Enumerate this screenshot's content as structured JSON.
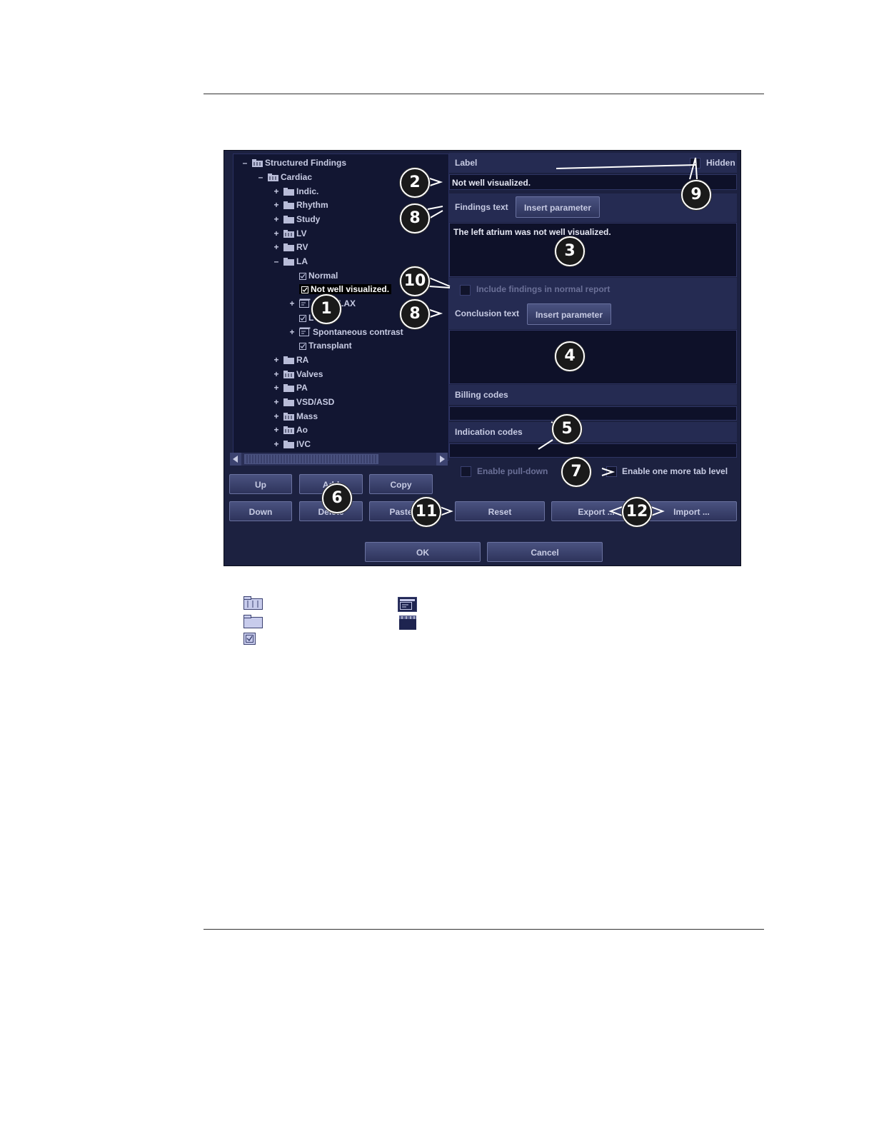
{
  "tree": {
    "root": "Structured Findings",
    "cardiac": "Cardiac",
    "items": {
      "indic": "Indic.",
      "rhythm": "Rhythm",
      "study": "Study",
      "lv": "LV",
      "rv": "RV",
      "la": "LA",
      "normal": "Normal",
      "not_well": "Not well visualized.",
      "lax": "LAX",
      "l_item": "L",
      "spont": "Spontaneous contrast",
      "transplant": "Transplant",
      "ra": "RA",
      "valves": "Valves",
      "pa": "PA",
      "vsd": "VSD/ASD",
      "mass": "Mass",
      "ao": "Ao",
      "ivc": "IVC"
    }
  },
  "tree_buttons": {
    "up": "Up",
    "add": "Add",
    "copy": "Copy",
    "down": "Down",
    "delete": "Delete",
    "paste": "Paste"
  },
  "panel": {
    "label_header": "Label",
    "hidden": "Hidden",
    "label_value": "Not well visualized.",
    "findings_text": "Findings text",
    "insert_parameter_1": "Insert parameter",
    "findings_value": "The left atrium was not well visualized.",
    "include_findings": "Include findings in normal report",
    "conclusion_text": "Conclusion text",
    "insert_parameter_2": "Insert parameter",
    "billing_codes": "Billing codes",
    "indication_codes": "Indication codes",
    "enable_pull_down": "Enable pull-down",
    "enable_tab_level": "Enable one more tab level",
    "reset": "Reset",
    "export": "Export ...",
    "import": "Import ..."
  },
  "dialog": {
    "ok": "OK",
    "cancel": "Cancel"
  },
  "callouts": [
    "1",
    "2",
    "3",
    "4",
    "5",
    "6",
    "7",
    "8",
    "8",
    "9",
    "10",
    "11",
    "12"
  ],
  "icons": [
    "folder-icon",
    "open-folder-icon",
    "checkbox-item-icon",
    "text-item-icon",
    "xws-folder-icon"
  ],
  "colors": {
    "background": "#1c2140",
    "tree_bg": "#121632",
    "text": "#c7cbe3",
    "button": "#3a4170"
  }
}
